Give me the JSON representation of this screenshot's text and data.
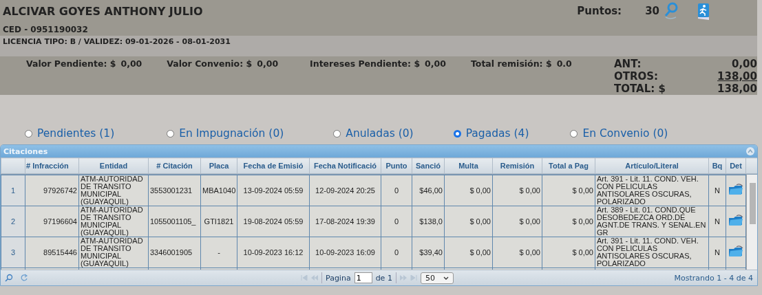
{
  "person": {
    "name": "ALCIVAR GOYES ANTHONY JULIO",
    "ced": "CED - 0951190032",
    "license": "LICENCIA TIPO: B   / VALIDEZ: 09-01-2026 - 08-01-2031",
    "points_label": "Puntos:",
    "points": "30"
  },
  "summary": {
    "items": [
      {
        "label": "Valor Pendiente: $",
        "value": "0,00"
      },
      {
        "label": "Valor Convenio: $",
        "value": "0,00"
      },
      {
        "label": "Intereses Pendiente: $",
        "value": "0,00"
      },
      {
        "label": "Total remisión: $",
        "value": "0.0"
      }
    ],
    "totals": [
      {
        "label": "ANT:",
        "value": "0,00",
        "link": false
      },
      {
        "label": "OTROS:",
        "value": "138,00",
        "link": true
      },
      {
        "label": "TOTAL: $",
        "value": "138,00",
        "link": false
      }
    ]
  },
  "filters": [
    {
      "label": "Pendientes (1)",
      "selected": false
    },
    {
      "label": "En Impugnación (0)",
      "selected": false
    },
    {
      "label": "Anuladas (0)",
      "selected": false
    },
    {
      "label": "Pagadas (4)",
      "selected": true
    },
    {
      "label": "En Convenio (0)",
      "selected": false
    }
  ],
  "grid": {
    "caption": "Citaciones",
    "columns": [
      "# Infracción",
      "Entidad",
      "# Citación",
      "Placa",
      "Fecha de Emisió",
      "Fecha Notificació",
      "Punto",
      "Sanció",
      "Multa",
      "Remisión",
      "Total a Pag",
      "Artículo/Literal",
      "Bq",
      "Det"
    ],
    "rows": [
      {
        "num": "1",
        "cells": [
          "97926742",
          "ATM-AUTORIDAD DE TRANSITO MUNICIPAL (GUAYAQUIL)",
          "3553001231",
          "MBA1040",
          "13-09-2024 05:59",
          "12-09-2024 20:25",
          "0",
          "$46,00",
          "$ 0,00",
          "$ 0,00",
          "$ 0,00",
          "Art. 391 - Lit. 11. COND. VEH. CON PELICULAS ANTISOLARES OSCURAS, POLARIZADO",
          "N"
        ]
      },
      {
        "num": "2",
        "cells": [
          "97196604",
          "ATM-AUTORIDAD DE TRANSITO MUNICIPAL (GUAYAQUIL)",
          "1055001105_",
          "GTI1821",
          "19-08-2024 05:59",
          "17-08-2024 19:39",
          "0",
          "$138,0",
          "$ 0,00",
          "$ 0,00",
          "$ 0,00",
          "Art. 389 - Lit. 01. COND.QUE DESOBEDEZCA ORD.DE AGNT.DE TRANS. Y SENAL.EN GR",
          "N"
        ]
      },
      {
        "num": "3",
        "cells": [
          "89515446",
          "ATM-AUTORIDAD DE TRANSITO MUNICIPAL (GUAYAQUIL)",
          "3346001905",
          "-",
          "10-09-2023 16:12",
          "10-09-2023 16:09",
          "0",
          "$39,40",
          "$ 0,00",
          "$ 0,00",
          "$ 0,00",
          "Art. 391 - Lit. 11. COND. VEH. CON PELICULAS ANTISOLARES OSCURAS, POLARIZADO",
          "N"
        ]
      }
    ],
    "pager": {
      "page_label": "Pagina",
      "page": "1",
      "of_label": "de 1",
      "page_size": "50",
      "info": "Mostrando 1 - 4 de 4"
    }
  }
}
